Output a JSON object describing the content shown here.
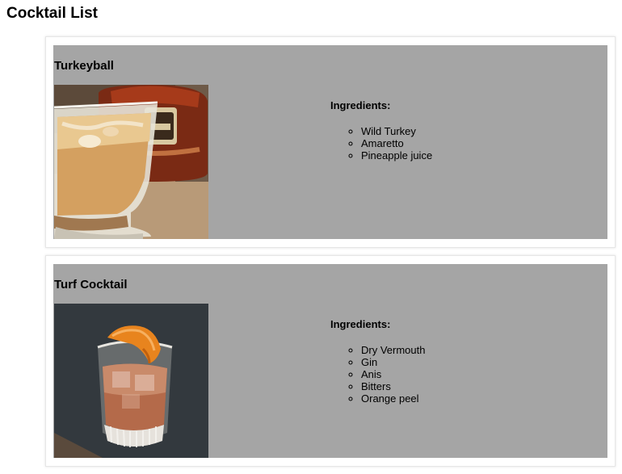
{
  "page": {
    "title": "Cocktail List"
  },
  "cocktails": [
    {
      "name": "Turkeyball",
      "image": "turkeyball-cocktail-photo",
      "ingredients_label": "Ingredients:",
      "ingredients": [
        "Wild Turkey",
        "Amaretto",
        "Pineapple juice"
      ]
    },
    {
      "name": "Turf Cocktail",
      "image": "turf-cocktail-photo",
      "ingredients_label": "Ingredients:",
      "ingredients": [
        "Dry Vermouth",
        "Gin",
        "Anis",
        "Bitters",
        "Orange peel"
      ]
    }
  ],
  "colors": {
    "card_background": "#a5a5a5",
    "page_background": "#ffffff"
  }
}
